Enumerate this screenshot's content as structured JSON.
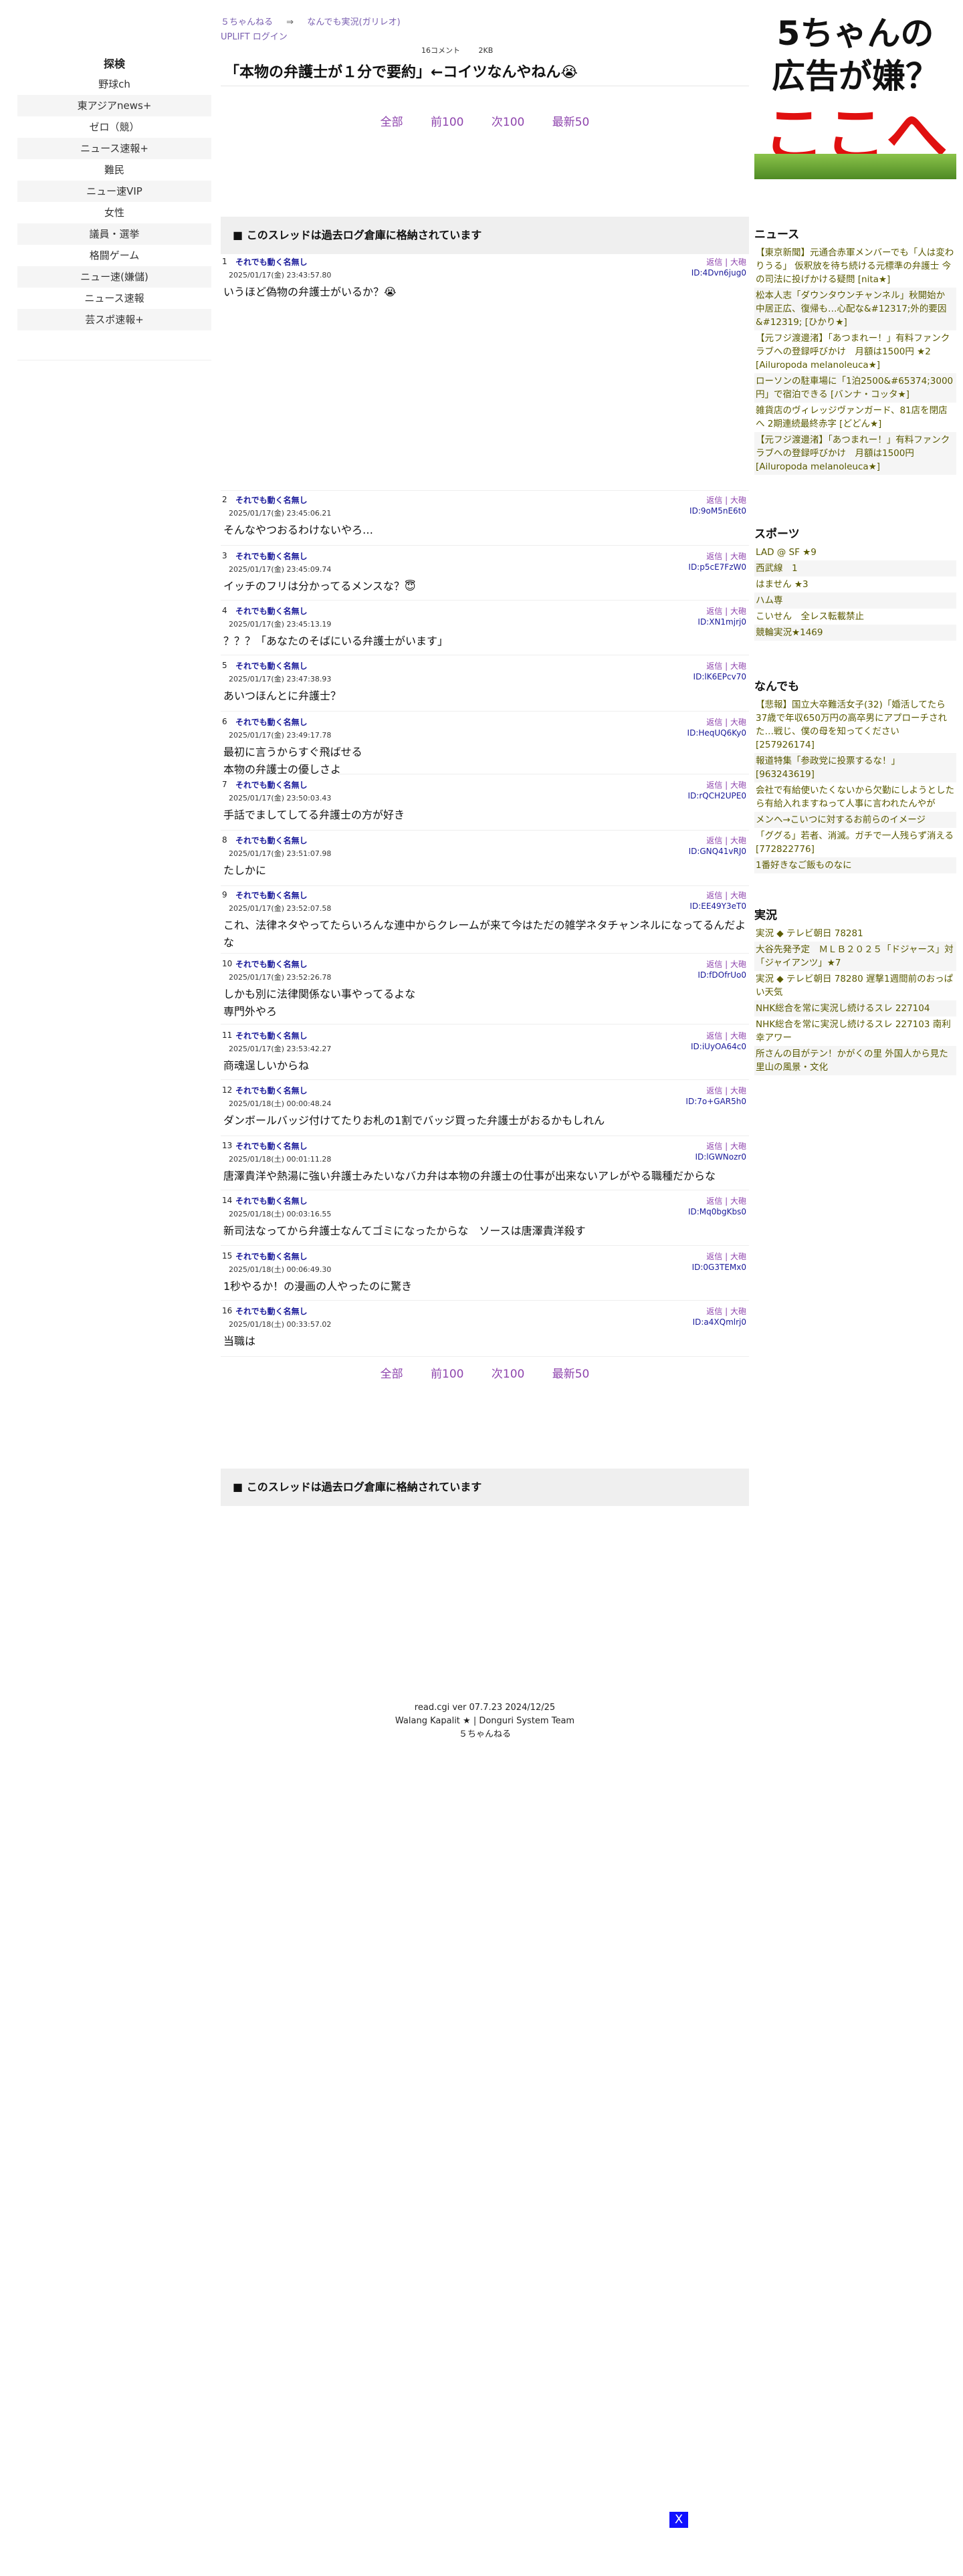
{
  "left_nav": {
    "heading": "探検",
    "items": [
      "野球ch",
      "東アジアnews+",
      "ゼロ（競）",
      "ニュース速報+",
      "難民",
      "ニュー速VIP",
      "女性",
      "議員・選挙",
      "格闘ゲーム",
      "ニュー速(嫌儲)",
      "ニュース速報",
      "芸スポ速報+"
    ]
  },
  "header": {
    "breadcrumb_home": "５ちゃんねる",
    "breadcrumb_arrow": "⇒",
    "breadcrumb_board": "なんでも実況(ガリレオ)",
    "login": "UPLIFT ログイン",
    "comments": "16コメント",
    "size": "2KB",
    "title": "「本物の弁護士が１分で要約」←コイツなんやねん😭"
  },
  "pager": {
    "all": "全部",
    "prev": "前100",
    "next": "次100",
    "latest": "最新50"
  },
  "archive_notice": "■ このスレッドは過去ログ倉庫に格納されています",
  "post_tools": {
    "reply": "返信",
    "sep": "|",
    "ng": "大砲"
  },
  "posts": [
    {
      "num": "1",
      "name": "それでも動く名無し",
      "date": "2025/01/17(金) 23:43:57.80",
      "id": "ID:4Dvn6jug0",
      "body": "いうほど偽物の弁護士がいるか？😭"
    },
    {
      "num": "2",
      "name": "それでも動く名無し",
      "date": "2025/01/17(金) 23:45:06.21",
      "id": "ID:9oM5nE6t0",
      "body": "そんなやつおるわけないやろ…"
    },
    {
      "num": "3",
      "name": "それでも動く名無し",
      "date": "2025/01/17(金) 23:45:09.74",
      "id": "ID:p5cE7FzW0",
      "body": "イッチのフリは分かってるメンスな？😇"
    },
    {
      "num": "4",
      "name": "それでも動く名無し",
      "date": "2025/01/17(金) 23:45:13.19",
      "id": "ID:XN1mjrj0",
      "body": "？？？「あなたのそばにいる弁護士がいます」"
    },
    {
      "num": "5",
      "name": "それでも動く名無し",
      "date": "2025/01/17(金) 23:47:38.93",
      "id": "ID:lK6EPcv70",
      "body": "あいつほんとに弁護士？"
    },
    {
      "num": "6",
      "name": "それでも動く名無し",
      "date": "2025/01/17(金) 23:49:17.78",
      "id": "ID:HeqUQ6Ky0",
      "body": "最初に言うからすぐ飛ばせる\n本物の弁護士の優しさよ"
    },
    {
      "num": "7",
      "name": "それでも動く名無し",
      "date": "2025/01/17(金) 23:50:03.43",
      "id": "ID:rQCH2UPE0",
      "body": "手話でましてしてる弁護士の方が好き"
    },
    {
      "num": "8",
      "name": "それでも動く名無し",
      "date": "2025/01/17(金) 23:51:07.98",
      "id": "ID:GNQ41vRJ0",
      "body": "たしかに"
    },
    {
      "num": "9",
      "name": "それでも動く名無し",
      "date": "2025/01/17(金) 23:52:07.58",
      "id": "ID:EE49Y3eT0",
      "body": "これ、法律ネタやってたらいろんな連中からクレームが来て今はただの雑学ネタチャンネルになってるんだよな"
    },
    {
      "num": "10",
      "name": "それでも動く名無し",
      "date": "2025/01/17(金) 23:52:26.78",
      "id": "ID:fDOfrUo0",
      "body": "しかも別に法律関係ない事やってるよな\n専門外やろ"
    },
    {
      "num": "11",
      "name": "それでも動く名無し",
      "date": "2025/01/17(金) 23:53:42.27",
      "id": "ID:iUyOA64c0",
      "body": "商魂逞しいからね"
    },
    {
      "num": "12",
      "name": "それでも動く名無し",
      "date": "2025/01/18(土) 00:00:48.24",
      "id": "ID:7o+GAR5h0",
      "body": "ダンボールバッジ付けてたりお札の1割でバッジ買った弁護士がおるかもしれん"
    },
    {
      "num": "13",
      "name": "それでも動く名無し",
      "date": "2025/01/18(土) 00:01:11.28",
      "id": "ID:lGWNozr0",
      "body": "唐澤貴洋や熱湯に強い弁護士みたいなバカ弁は本物の弁護士の仕事が出来ないアレがやる職種だからな"
    },
    {
      "num": "14",
      "name": "それでも動く名無し",
      "date": "2025/01/18(土) 00:03:16.55",
      "id": "ID:Mq0bgKbs0",
      "body": "新司法なってから弁護士なんてゴミになったからな　ソースは唐澤貴洋殺す"
    },
    {
      "num": "15",
      "name": "それでも動く名無し",
      "date": "2025/01/18(土) 00:06:49.30",
      "id": "ID:0G3TEMx0",
      "body": "1秒やるか！の漫画の人やったのに驚き"
    },
    {
      "num": "16",
      "name": "それでも動く名無し",
      "date": "2025/01/18(土) 00:33:57.02",
      "id": "ID:a4XQmlrj0",
      "body": "当職は"
    }
  ],
  "footer": {
    "line1": "read.cgi ver 07.7.23 2024/12/25",
    "line2": "Walang Kapalit ★ | Donguri System Team",
    "line3": "５ちゃんねる"
  },
  "ad": {
    "line1": "5ちゃんの",
    "line2": "広告が嫌？",
    "line3": "ここへ"
  },
  "right": {
    "news_heading": "ニュース",
    "news": [
      "【東京新聞】元通合赤軍メンバーでも「人は変わりうる」 仮釈放を待ち続ける元標準の弁護士 今の司法に投げかける疑問 [nita★]",
      "松本人志「ダウンタウンチャンネル」秋開始か 中居正広、復帰も…心配な&#12317;外的要因&#12319; [ひかり★]",
      "【元フジ渡邊渚】「あつまれー！」有料ファンクラブへの登録呼びかけ　月額は1500円 ★2 [Ailuropoda melanoleuca★]",
      "ローソンの駐車場に「1泊2500&#65374;3000円」で宿泊できる [バンナ・コッタ★]",
      "雑貨店のヴィレッジヴァンガード、81店を閉店へ 2期連続最終赤字 [どどん★]",
      "【元フジ渡邊渚】「あつまれー！」有料ファンクラブへの登録呼びかけ　月額は1500円 [Ailuropoda melanoleuca★]"
    ],
    "sports_heading": "スポーツ",
    "sports": [
      "LAD @ SF ★9",
      "西武線　1",
      "はません ★3",
      "ハム専",
      "こいせん　全レス転載禁止",
      "競輪実況★1469"
    ],
    "nandemo_heading": "なんでも",
    "nandemo": [
      "【悲報】国立大卒難活女子(32)「婚活してたら37歳で年収650万円の高卒男にアプローチされた…戦じ、僕の母を知ってください [257926174]",
      "報道特集「参政党に投票するな！」 [963243619]",
      "会社で有給使いたくないから欠勤にしようとしたら有給入れますねって人事に言われたんやが",
      "メンヘ→こいつに対するお前らのイメージ",
      "「ググる」若者、消滅。ガチで一人残らず消える [772822776]",
      "1番好きなご飯ものなに"
    ],
    "live_heading": "実況",
    "live": [
      "実況 ◆ テレビ朝日 78281",
      "大谷先発予定　ＭＬＢ２０２５「ドジャース」対「ジャイアンツ」★7",
      "実況 ◆ テレビ朝日 78280 遅撃1週間前のおっぱい天気",
      "NHK総合を常に実況し続けるスレ 227104",
      "NHK総合を常に実況し続けるスレ 227103 南利幸アワー",
      "所さんの目がテン！かがくの里 外国人から見た里山の風景・文化"
    ]
  },
  "close_label": "X"
}
